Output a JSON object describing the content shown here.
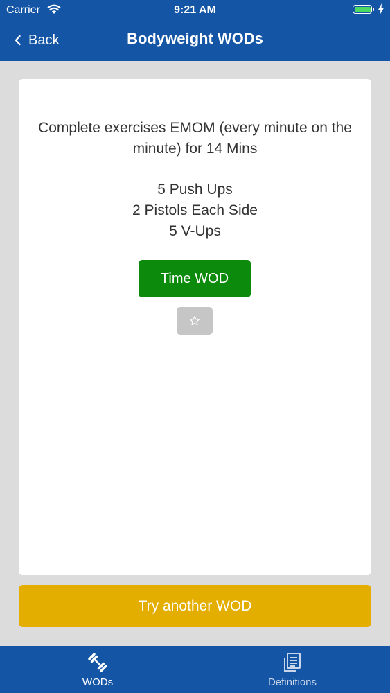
{
  "status_bar": {
    "carrier": "Carrier",
    "time": "9:21 AM",
    "battery_color": "#4cd964"
  },
  "nav": {
    "back_label": "Back",
    "back_icon": "chevron-left-icon",
    "title": "Bodyweight WODs",
    "bar_color": "#1455a6"
  },
  "workout": {
    "description": "Complete exercises EMOM (every minute on the minute) for 14 Mins",
    "exercises": [
      "5 Push Ups",
      "2 Pistols Each Side",
      "5 V-Ups"
    ],
    "time_button_label": "Time WOD",
    "time_button_color": "#0b8a0b",
    "favorite_icon": "star-outline-icon"
  },
  "try_another": {
    "label": "Try another WOD",
    "color": "#e3ae00"
  },
  "tabs": [
    {
      "label": "WODs",
      "icon": "dumbbell-icon",
      "selected": true
    },
    {
      "label": "Definitions",
      "icon": "documents-icon",
      "selected": false
    }
  ]
}
